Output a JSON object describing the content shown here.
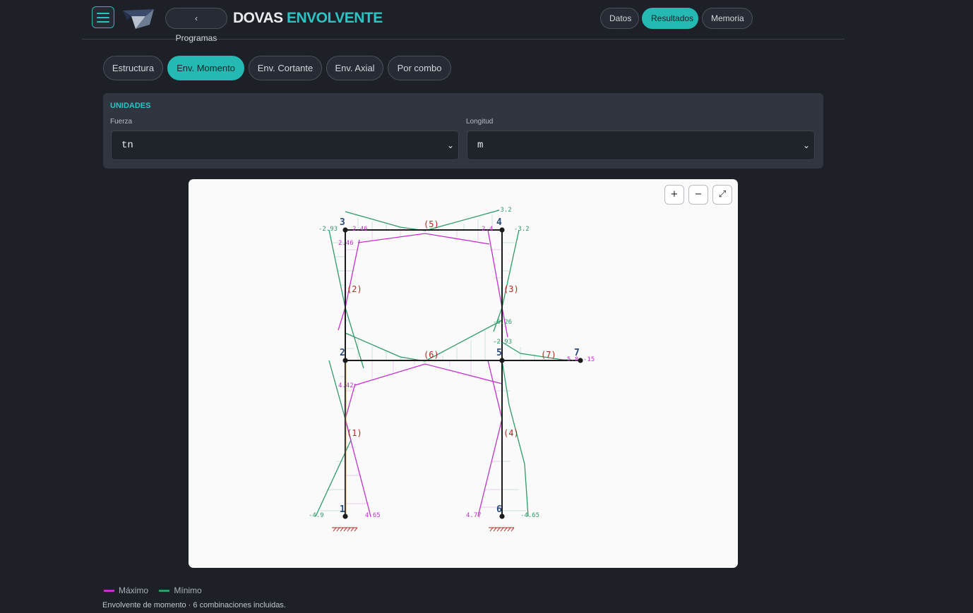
{
  "header": {
    "back_label": "‹ Programas",
    "brand_part1": "DOVAS",
    "brand_part2": "ENVOLVENTE",
    "nav": [
      "Datos",
      "Resultados",
      "Memoria"
    ],
    "nav_active": "Resultados"
  },
  "tabs": [
    "Estructura",
    "Env. Momento",
    "Env. Cortante",
    "Env. Axial",
    "Por combo"
  ],
  "tab_active": "Env. Momento",
  "units": {
    "title": "UNIDADES",
    "fuerza_label": "Fuerza",
    "fuerza_value": "tn",
    "longitud_label": "Longitud",
    "longitud_value": "m"
  },
  "zoom": {
    "in": "+",
    "out": "−",
    "fit": "⤢"
  },
  "diagram": {
    "nodes": [
      "1",
      "2",
      "3",
      "4",
      "5",
      "6",
      "7"
    ],
    "members": [
      "(1)",
      "(2)",
      "(3)",
      "(4)",
      "(5)",
      "(6)",
      "(7)"
    ],
    "values": {
      "n3_min": "-2.93",
      "n3_max": "2.46",
      "n3_max_col": "2.46",
      "top_min": "-3.2",
      "n4_max": "2.4",
      "n4_min": "-3.2",
      "n5_min_col": "-6.26",
      "n5_min_beam": "-2.93",
      "n7_max": "5.8",
      "n7_min": "-15",
      "n2_max": "4.42",
      "n1_min": "-4.9",
      "n1_max": "4.65",
      "n6_max": "4.77",
      "n6_min": "-4.65"
    },
    "colors": {
      "max": "#c42fd0",
      "min": "#2e9a68",
      "frame": "#1b1b1b",
      "node_label": "#2a4d7a",
      "member_label": "#b5291f"
    }
  },
  "legend": {
    "max_label": "Máximo",
    "min_label": "Mínimo",
    "max_color": "#c42fd0",
    "min_color": "#2e9a68"
  },
  "footnote": "Envolvente de momento · 6 combinaciones incluidas."
}
